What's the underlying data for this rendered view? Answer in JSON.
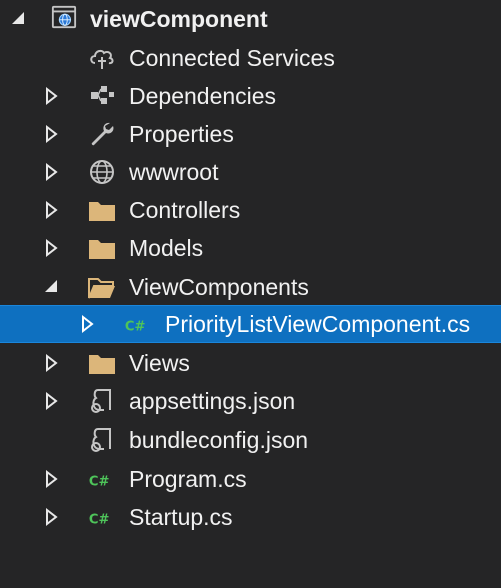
{
  "solution_explorer": {
    "root": {
      "label": "viewComponent",
      "icon": "web-project-icon",
      "expanded": true
    },
    "items": [
      {
        "label": "Connected Services",
        "icon": "connected-services-icon",
        "expandable": false,
        "expanded": false
      },
      {
        "label": "Dependencies",
        "icon": "dependencies-icon",
        "expandable": true,
        "expanded": false
      },
      {
        "label": "Properties",
        "icon": "wrench-icon",
        "expandable": true,
        "expanded": false
      },
      {
        "label": "wwwroot",
        "icon": "globe-icon",
        "expandable": true,
        "expanded": false
      },
      {
        "label": "Controllers",
        "icon": "folder-icon",
        "expandable": true,
        "expanded": false
      },
      {
        "label": "Models",
        "icon": "folder-icon",
        "expandable": true,
        "expanded": false
      },
      {
        "label": "ViewComponents",
        "icon": "folder-open-icon",
        "expandable": true,
        "expanded": true
      },
      {
        "label": "PriorityListViewComponent.cs",
        "icon": "csharp-file-icon",
        "cs_glyph": "C#",
        "expandable": true,
        "expanded": false,
        "selected": true
      },
      {
        "label": "Views",
        "icon": "folder-icon",
        "expandable": true,
        "expanded": false
      },
      {
        "label": "appsettings.json",
        "icon": "json-file-icon",
        "expandable": true,
        "expanded": false
      },
      {
        "label": "bundleconfig.json",
        "icon": "json-file-icon",
        "expandable": false,
        "expanded": false
      },
      {
        "label": "Program.cs",
        "icon": "csharp-file-icon",
        "cs_glyph": "C#",
        "expandable": true,
        "expanded": false
      },
      {
        "label": "Startup.cs",
        "icon": "csharp-file-icon",
        "cs_glyph": "C#",
        "expandable": true,
        "expanded": false
      }
    ],
    "colors": {
      "background": "#252526",
      "selection": "#0e70c0",
      "text": "#f1f1f1",
      "folder": "#dcb67a",
      "csharp": "#4ec45a",
      "icon_gray": "#c5c5c5"
    }
  }
}
